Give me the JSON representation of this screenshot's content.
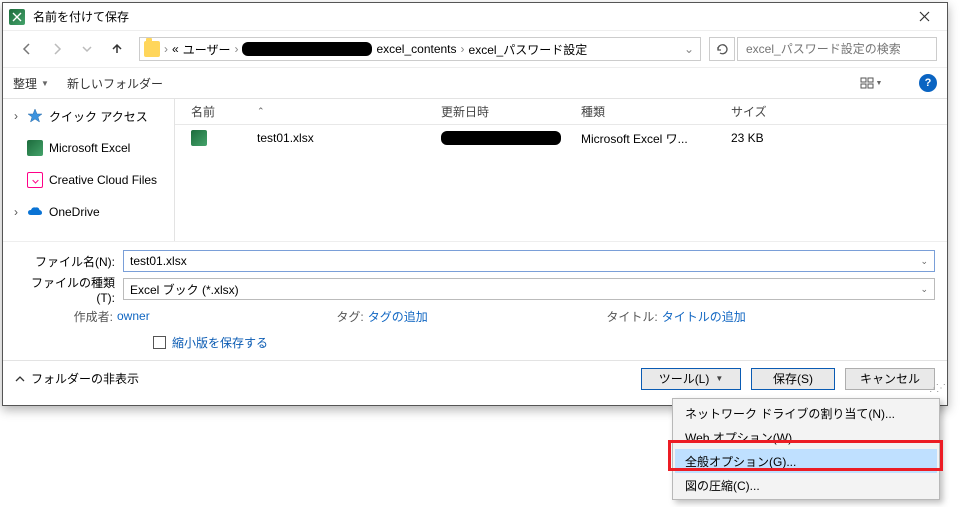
{
  "title": "名前を付けて保存",
  "breadcrumb": {
    "prefix": "«",
    "user": "ユーザー",
    "seg_contents": "excel_contents",
    "seg_password": "excel_パスワード設定"
  },
  "search": {
    "placeholder": "excel_パスワード設定の検索"
  },
  "toolbar": {
    "organize": "整理",
    "new_folder": "新しいフォルダー"
  },
  "tree": {
    "quick_access": "クイック アクセス",
    "ms_excel": "Microsoft Excel",
    "cc_files": "Creative Cloud Files",
    "onedrive": "OneDrive"
  },
  "columns": {
    "name": "名前",
    "date": "更新日時",
    "type": "種類",
    "size": "サイズ"
  },
  "files": [
    {
      "name": "test01.xlsx",
      "type": "Microsoft Excel ワ...",
      "size": "23 KB"
    }
  ],
  "fields": {
    "filename_label": "ファイル名(N):",
    "filename_value": "test01.xlsx",
    "filetype_label": "ファイルの種類(T):",
    "filetype_value": "Excel ブック (*.xlsx)",
    "author_label": "作成者:",
    "author_value": "owner",
    "tag_label": "タグ:",
    "tag_value": "タグの追加",
    "title_label": "タイトル:",
    "title_value": "タイトルの追加",
    "thumb_label": "縮小版を保存する"
  },
  "bottom": {
    "hide_folders": "フォルダーの非表示",
    "tools": "ツール(L)",
    "save": "保存(S)",
    "cancel": "キャンセル"
  },
  "menu": {
    "map_drive": "ネットワーク ドライブの割り当て(N)...",
    "web_options": "Web オプション(W)...",
    "general_options": "全般オプション(G)...",
    "compress_pictures": "図の圧縮(C)..."
  }
}
